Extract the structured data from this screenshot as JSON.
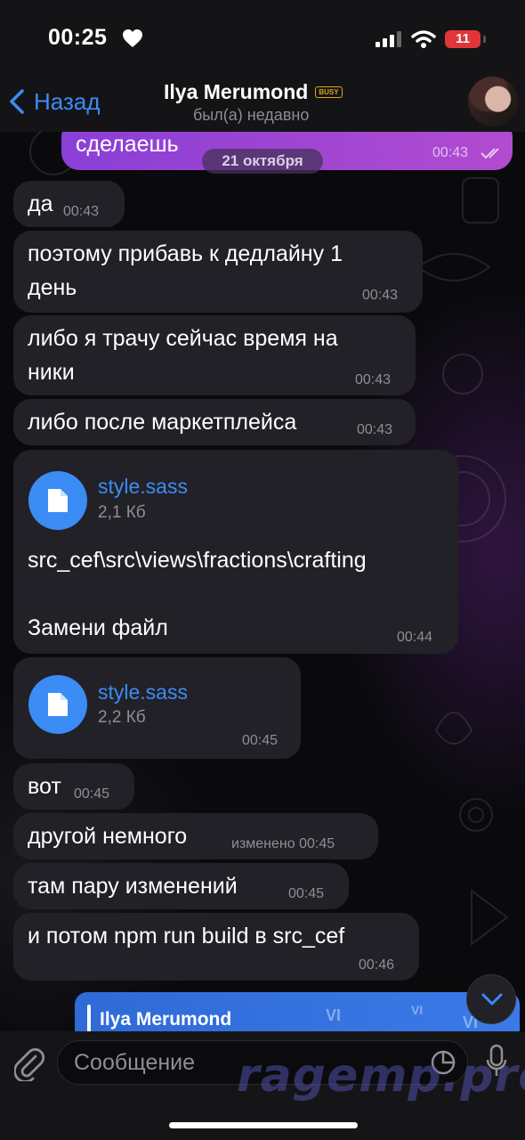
{
  "status_bar": {
    "time": "00:25",
    "battery": "11"
  },
  "header": {
    "back_label": "Назад",
    "title": "Ilya Merumond",
    "badge": "BUSY",
    "subtitle": "был(а) недавно"
  },
  "date_separator": "21 октября",
  "outgoing": {
    "text": "сделаешь",
    "time": "00:43"
  },
  "messages": [
    {
      "text": "да",
      "time": "00:43"
    },
    {
      "text_line1": "поэтому прибавь к дедлайну 1",
      "text_line2": "день",
      "time": "00:43"
    },
    {
      "text_line1": "либо я трачу сейчас время на",
      "text_line2": "ники",
      "time": "00:43"
    },
    {
      "text": "либо после маркетплейса",
      "time": "00:43"
    },
    {
      "file_name": "style.sass",
      "file_size": "2,1 Кб",
      "caption_line1": "src_cef\\src\\views\\fractions\\crafting",
      "caption_line2": "Замени файл",
      "time": "00:44"
    },
    {
      "file_name": "style.sass",
      "file_size": "2,2 Кб",
      "time": "00:45"
    },
    {
      "text": "вот",
      "time": "00:45"
    },
    {
      "text": "другой немного",
      "time": "изменено 00:45"
    },
    {
      "text": "там пару изменений",
      "time": "00:45"
    },
    {
      "text": "и потом npm run build в src_cef",
      "time": "00:46"
    }
  ],
  "reply": {
    "name": "Ilya Merumond",
    "deco": "VI"
  },
  "input": {
    "placeholder": "Сообщение"
  },
  "watermark": "ragemp.pro",
  "icons": [
    "heart-icon",
    "signal-icon",
    "wifi-icon",
    "chevron-left-icon",
    "double-check-icon",
    "document-icon",
    "chevron-down-icon",
    "paperclip-icon",
    "sticker-icon",
    "microphone-icon"
  ],
  "colors": {
    "accent": "#3b8cf5",
    "outgoing_start": "#8a3fd6",
    "outgoing_end": "#b24bd0",
    "bubble": "#222127",
    "battery": "#e0353b",
    "badge": "#e3a11e"
  }
}
